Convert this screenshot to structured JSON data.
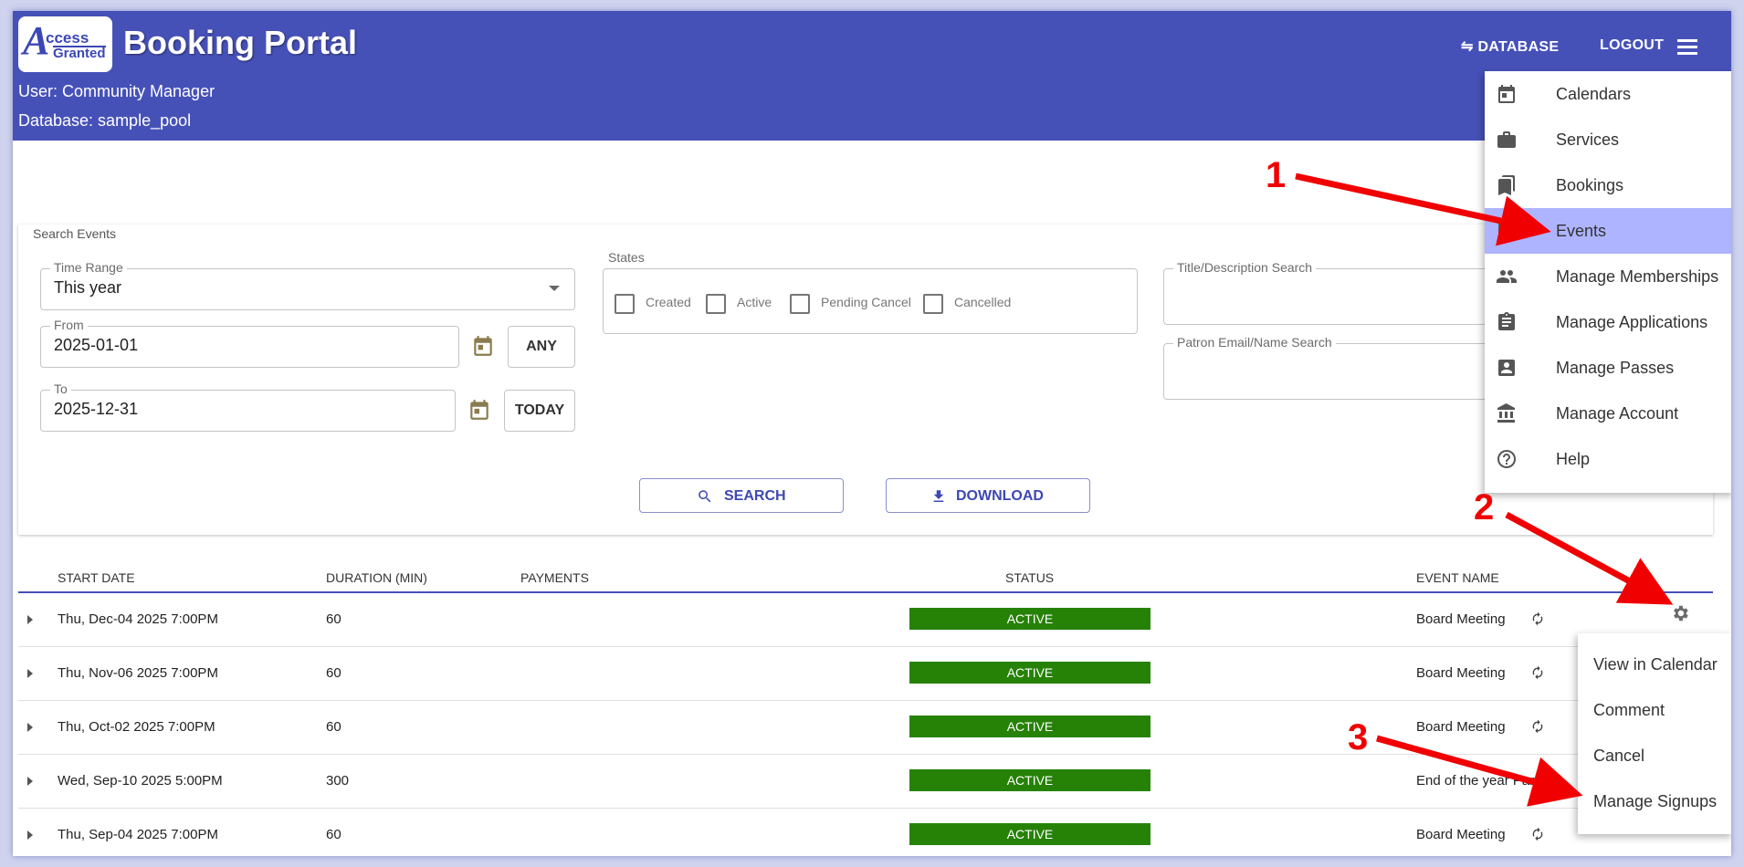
{
  "app": {
    "logo_big": "A",
    "logo_line1": "ccess",
    "logo_line2": "Granted",
    "title": "Booking Portal",
    "user_line": "User: Community Manager",
    "database_line": "Database: sample_pool",
    "database_button": "⇋ DATABASE",
    "logout_button": "LOGOUT",
    "menu_icon": "hamburger-menu-icon",
    "header_color": "#4651b8"
  },
  "search": {
    "title": "Search Events",
    "time_range": {
      "label": "Time Range",
      "value": "This year"
    },
    "from": {
      "label": "From",
      "value": "2025-01-01"
    },
    "to": {
      "label": "To",
      "value": "2025-12-31"
    },
    "any_button": "ANY",
    "today_button": "TODAY",
    "states": {
      "label": "States",
      "options": [
        {
          "label": "Created",
          "checked": false
        },
        {
          "label": "Active",
          "checked": false
        },
        {
          "label": "Pending Cancel",
          "checked": false
        },
        {
          "label": "Cancelled",
          "checked": false
        }
      ]
    },
    "title_search": {
      "label": "Title/Description Search",
      "value": ""
    },
    "patron_search": {
      "label": "Patron Email/Name Search",
      "value": ""
    },
    "search_button": "SEARCH",
    "download_button": "DOWNLOAD"
  },
  "table": {
    "columns": [
      "START DATE",
      "DURATION (MIN)",
      "PAYMENTS",
      "STATUS",
      "EVENT NAME"
    ],
    "rows": [
      {
        "start": "Thu, Dec-04 2025 7:00PM",
        "duration": "60",
        "payments": "",
        "status": "ACTIVE",
        "event": "Board Meeting",
        "recurring": true
      },
      {
        "start": "Thu, Nov-06 2025 7:00PM",
        "duration": "60",
        "payments": "",
        "status": "ACTIVE",
        "event": "Board Meeting",
        "recurring": true
      },
      {
        "start": "Thu, Oct-02 2025 7:00PM",
        "duration": "60",
        "payments": "",
        "status": "ACTIVE",
        "event": "Board Meeting",
        "recurring": true
      },
      {
        "start": "Wed, Sep-10 2025 5:00PM",
        "duration": "300",
        "payments": "",
        "status": "ACTIVE",
        "event": "End of the year Party",
        "recurring": false
      },
      {
        "start": "Thu, Sep-04 2025 7:00PM",
        "duration": "60",
        "payments": "",
        "status": "ACTIVE",
        "event": "Board Meeting",
        "recurring": true
      }
    ],
    "status_color": "#268207"
  },
  "nav_menu": {
    "items": [
      {
        "label": "Calendars",
        "icon": "calendar-icon"
      },
      {
        "label": "Services",
        "icon": "briefcase-icon"
      },
      {
        "label": "Bookings",
        "icon": "bookmarks-icon"
      },
      {
        "label": "Events",
        "icon": "list-icon",
        "selected": true
      },
      {
        "label": "Manage Memberships",
        "icon": "people-icon"
      },
      {
        "label": "Manage Applications",
        "icon": "clipboard-icon"
      },
      {
        "label": "Manage Passes",
        "icon": "badge-icon"
      },
      {
        "label": "Manage Account",
        "icon": "bank-icon"
      },
      {
        "label": "Help",
        "icon": "help-icon"
      }
    ],
    "selected_color": "#aeb4ff"
  },
  "context_menu": {
    "items": [
      "View in Calendar",
      "Comment",
      "Cancel",
      "Manage Signups"
    ]
  },
  "annotations": {
    "step1": "1",
    "step2": "2",
    "step3": "3",
    "color": "#f00000"
  }
}
